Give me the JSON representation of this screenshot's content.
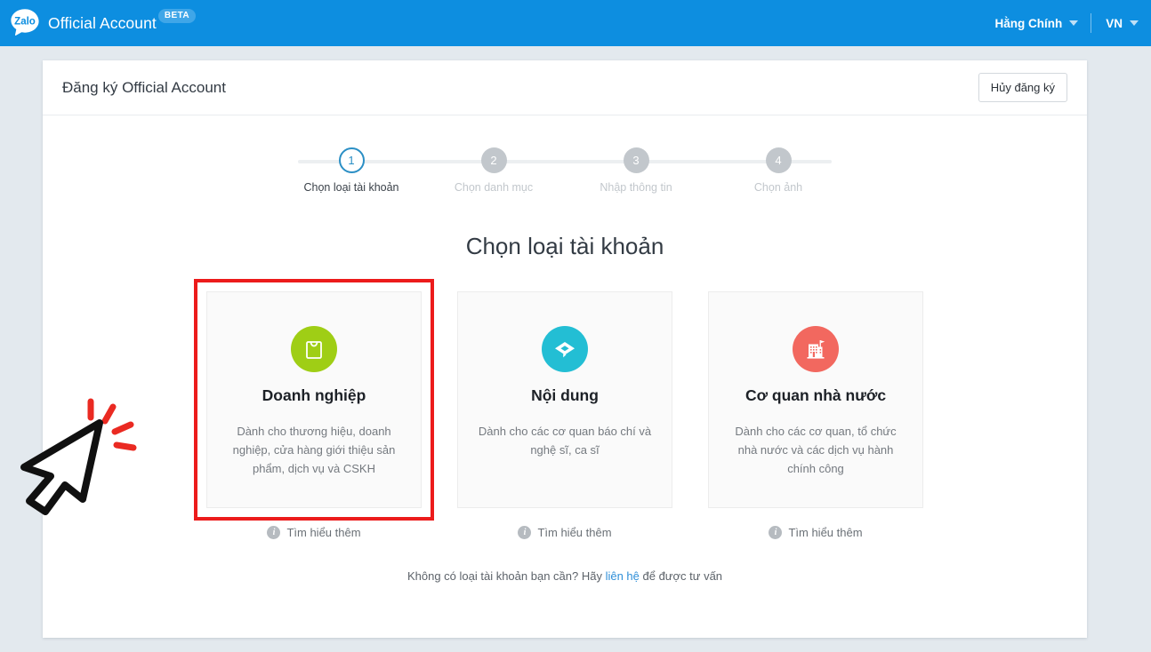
{
  "header": {
    "logo_text": "Zalo",
    "brand_title": "Official Account",
    "beta_badge": "BETA",
    "user_name": "Hằng Chính",
    "language": "VN"
  },
  "panel": {
    "title": "Đăng ký Official Account",
    "cancel_label": "Hủy đăng ký"
  },
  "stepper": {
    "steps": [
      {
        "number": "1",
        "label": "Chọn loại tài khoản",
        "active": true
      },
      {
        "number": "2",
        "label": "Chọn danh mục",
        "active": false
      },
      {
        "number": "3",
        "label": "Nhập thông tin",
        "active": false
      },
      {
        "number": "4",
        "label": "Chọn ảnh",
        "active": false
      }
    ]
  },
  "main": {
    "heading": "Chọn loại tài khoản",
    "cards": [
      {
        "title": "Doanh nghiệp",
        "desc": "Dành cho thương hiệu, doanh nghiệp, cửa hàng giới thiệu sản phẩm, dịch vụ và CSKH",
        "icon": "shopping-bag-icon",
        "icon_color": "#9fce15",
        "learn_more": "Tìm hiểu thêm",
        "selected": true
      },
      {
        "title": "Nội dung",
        "desc": "Dành cho các cơ quan báo chí và nghệ sĩ, ca sĩ",
        "icon": "content-diamond-icon",
        "icon_color": "#23bed4",
        "learn_more": "Tìm hiểu thêm",
        "selected": false
      },
      {
        "title": "Cơ quan nhà nước",
        "desc": "Dành cho các cơ quan, tổ chức nhà nước và các dịch vụ hành chính công",
        "icon": "government-building-icon",
        "icon_color": "#f2685f",
        "learn_more": "Tìm hiểu thêm",
        "selected": false
      }
    ],
    "footnote_before": "Không có loại tài khoản bạn cần? Hãy ",
    "footnote_link": "liên hệ",
    "footnote_after": " để được tư vấn"
  },
  "colors": {
    "header_blue": "#0d8ee0",
    "page_background": "#e3e9ee",
    "highlight_red": "#ec1b1b",
    "link_blue": "#2f8fd8",
    "active_step": "#2b8fc5"
  }
}
